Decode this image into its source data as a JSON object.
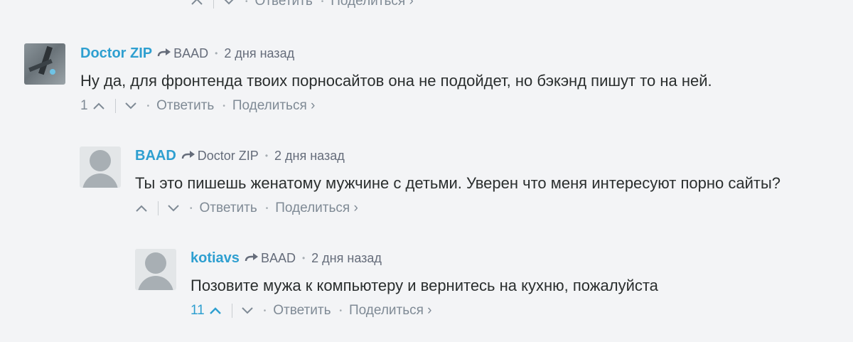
{
  "top_actions": {
    "reply_label": "Ответить",
    "share_label": "Поделиться ›"
  },
  "comments": [
    {
      "author": "Doctor ZIP",
      "reply_to": "BAAD",
      "time": "2 дня назад",
      "text": "Ну да, для фронтенда твоих порносайтов она не подойдет, но бэкэнд пишут то на ней.",
      "upvotes": "1",
      "reply_label": "Ответить",
      "share_label": "Поделиться ›",
      "avatar": "user-photo",
      "upvote_color": "#7f8a95"
    },
    {
      "author": "BAAD",
      "reply_to": "Doctor ZIP",
      "time": "2 дня назад",
      "text": "Ты это пишешь женатому мужчине с детьми. Уверен что меня интересуют порно сайты?",
      "upvotes": "",
      "reply_label": "Ответить",
      "share_label": "Поделиться ›",
      "avatar": "default-avatar",
      "upvote_color": "#7f8a95"
    },
    {
      "author": "kotiavs",
      "reply_to": "BAAD",
      "time": "2 дня назад",
      "text": "Позовите мужа к компьютеру и вернитесь на кухню, пожалуйста",
      "upvotes": "11",
      "reply_label": "Ответить",
      "share_label": "Поделиться ›",
      "avatar": "default-avatar",
      "upvote_color": "#2e9fd0"
    }
  ],
  "colors": {
    "background": "#f3f4f6",
    "author": "#2e9fd0",
    "meta": "#656c7a",
    "text": "#2a2e2e",
    "actions": "#7f8a95"
  },
  "icons": [
    "upvote-icon",
    "downvote-icon",
    "reply-arrow-icon"
  ]
}
